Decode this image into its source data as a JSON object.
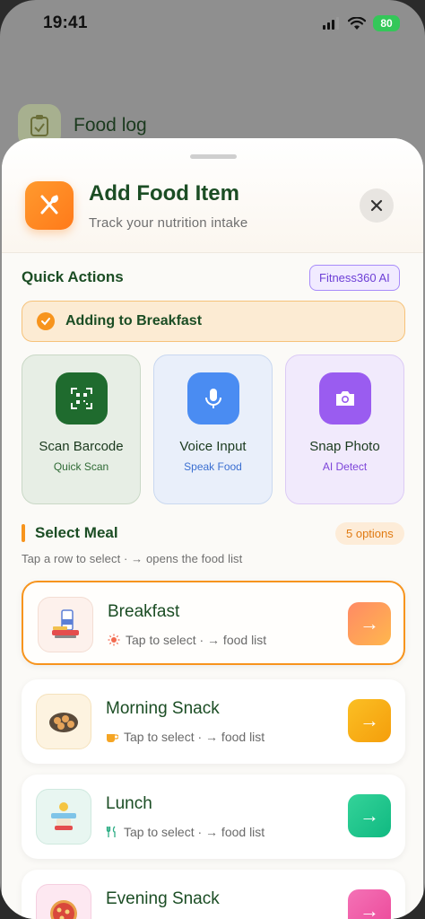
{
  "status": {
    "time": "19:41",
    "battery": "80"
  },
  "background": {
    "title": "Food log"
  },
  "header": {
    "title": "Add Food Item",
    "subtitle": "Track your nutrition intake"
  },
  "quick_actions": {
    "title": "Quick Actions",
    "badge": "Fitness360 AI",
    "adding_text": "Adding to Breakfast",
    "tiles": [
      {
        "title": "Scan Barcode",
        "subtitle": "Quick Scan",
        "icon": "qr-scan-icon"
      },
      {
        "title": "Voice Input",
        "subtitle": "Speak Food",
        "icon": "microphone-icon"
      },
      {
        "title": "Snap Photo",
        "subtitle": "AI Detect",
        "icon": "camera-icon"
      }
    ]
  },
  "select_meal": {
    "title": "Select Meal",
    "badge": "5 options",
    "subtitle": "Tap a row to select · → opens the food list",
    "meals": [
      {
        "title": "Breakfast",
        "subtitle": "Tap to select · → food list",
        "selected": true,
        "accent": "#ff7e5f"
      },
      {
        "title": "Morning Snack",
        "subtitle": "Tap to select · → food list",
        "selected": false,
        "accent": "#fbbf24"
      },
      {
        "title": "Lunch",
        "subtitle": "Tap to select · → food list",
        "selected": false,
        "accent": "#34d399"
      },
      {
        "title": "Evening Snack",
        "subtitle": "",
        "selected": false,
        "accent": "#f472b6"
      }
    ]
  },
  "colors": {
    "primary_green": "#1b4d24",
    "accent_orange": "#f7941d"
  }
}
